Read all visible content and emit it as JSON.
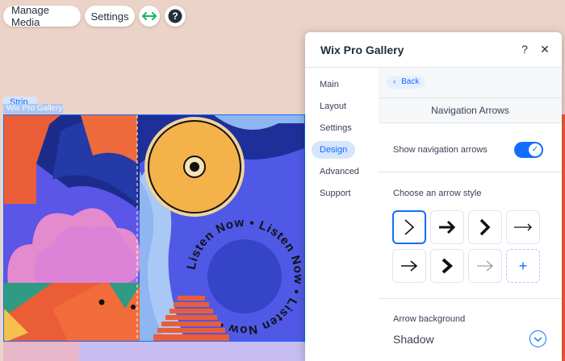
{
  "toolbar": {
    "manage_media_label": "Manage Media",
    "settings_label": "Settings",
    "stretch_icon": "horizontal-arrows-icon",
    "help_icon": "help-icon"
  },
  "canvas": {
    "strip_tag": "Strip",
    "gallery_tag": "Wix Pro Gallery",
    "gallery_text": "Listen Now • Listen Now • Listen Now •"
  },
  "panel": {
    "title": "Wix Pro Gallery",
    "help_symbol": "?",
    "close_symbol": "✕",
    "nav": [
      "Main",
      "Layout",
      "Settings",
      "Design",
      "Advanced",
      "Support"
    ],
    "active_nav": "Design",
    "back_label": "Back",
    "back_chevron": "‹",
    "section_title": "Navigation Arrows",
    "show_arrows_label": "Show navigation arrows",
    "show_arrows_on": true,
    "toggle_check": "✓",
    "arrow_style_label": "Choose an arrow style",
    "arrow_styles": [
      "chevron-thin",
      "arrow-bold",
      "chevron-bold",
      "arrow-long-thin",
      "arrow-regular",
      "chevron-heavy",
      "arrow-light",
      "add-custom"
    ],
    "add_symbol": "+",
    "arrow_background_label": "Arrow background",
    "arrow_background_value": "Shadow"
  },
  "colors": {
    "accent": "#116dff",
    "canvas_bg": "#ecd3c8"
  }
}
